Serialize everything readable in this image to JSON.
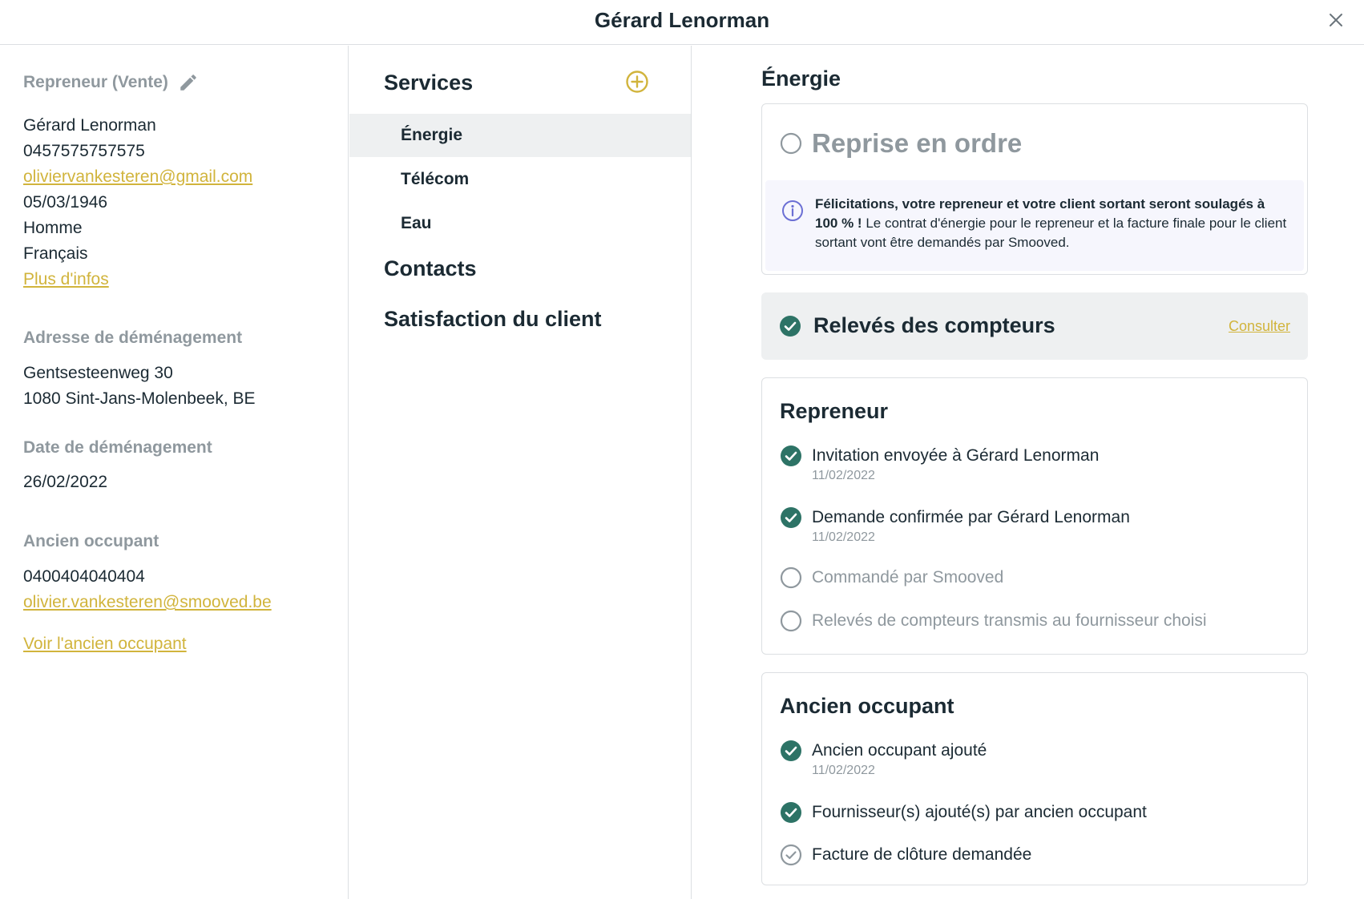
{
  "header": {
    "title": "Gérard Lenorman"
  },
  "repreneur": {
    "label": "Repreneur (Vente)",
    "name": "Gérard Lenorman",
    "phone": "0457575757575",
    "email": "oliviervankesteren@gmail.com",
    "birthdate": "05/03/1946",
    "gender": "Homme",
    "language": "Français",
    "more_link": "Plus d'infos"
  },
  "moving_address": {
    "label": "Adresse de déménagement",
    "line1": "Gentsesteenweg 30",
    "line2": "1080 Sint-Jans-Molenbeek, BE"
  },
  "moving_date": {
    "label": "Date de déménagement",
    "value": "26/02/2022"
  },
  "previous_occupant": {
    "label": "Ancien occupant",
    "phone": "0400404040404",
    "email": "olivier.vankesteren@smooved.be",
    "view_link": "Voir l'ancien occupant"
  },
  "nav": {
    "services": "Services",
    "items": [
      {
        "label": "Énergie",
        "active": true
      },
      {
        "label": "Télécom",
        "active": false
      },
      {
        "label": "Eau",
        "active": false
      }
    ],
    "contacts": "Contacts",
    "satisfaction": "Satisfaction du client"
  },
  "energy": {
    "title": "Énergie",
    "reprise": {
      "title": "Reprise en ordre",
      "info_bold": "Félicitations, votre repreneur et votre client sortant seront soulagés à 100 % !",
      "info_rest": " Le contrat d'énergie pour le repreneur et la facture finale pour le client sortant vont être demandés par Smooved."
    },
    "meters": {
      "title": "Relevés des compteurs",
      "action": "Consulter"
    },
    "repreneur_card": {
      "title": "Repreneur",
      "steps": [
        {
          "label": "Invitation envoyée à Gérard Lenorman",
          "date": "11/02/2022",
          "status": "done"
        },
        {
          "label": "Demande confirmée par Gérard Lenorman",
          "date": "11/02/2022",
          "status": "done"
        },
        {
          "label": "Commandé par Smooved",
          "status": "pending"
        },
        {
          "label": "Relevés de compteurs transmis au fournisseur choisi",
          "status": "pending"
        }
      ]
    },
    "ancien_card": {
      "title": "Ancien occupant",
      "steps": [
        {
          "label": "Ancien occupant ajouté",
          "date": "11/02/2022",
          "status": "done"
        },
        {
          "label": "Fournisseur(s) ajouté(s) par ancien occupant",
          "status": "done"
        },
        {
          "label": "Facture de clôture demandée",
          "status": "outline"
        }
      ]
    }
  },
  "colors": {
    "accent": "#d1b43c",
    "success": "#2d7366",
    "muted": "#8f989e",
    "info": "#6b6fd4"
  }
}
